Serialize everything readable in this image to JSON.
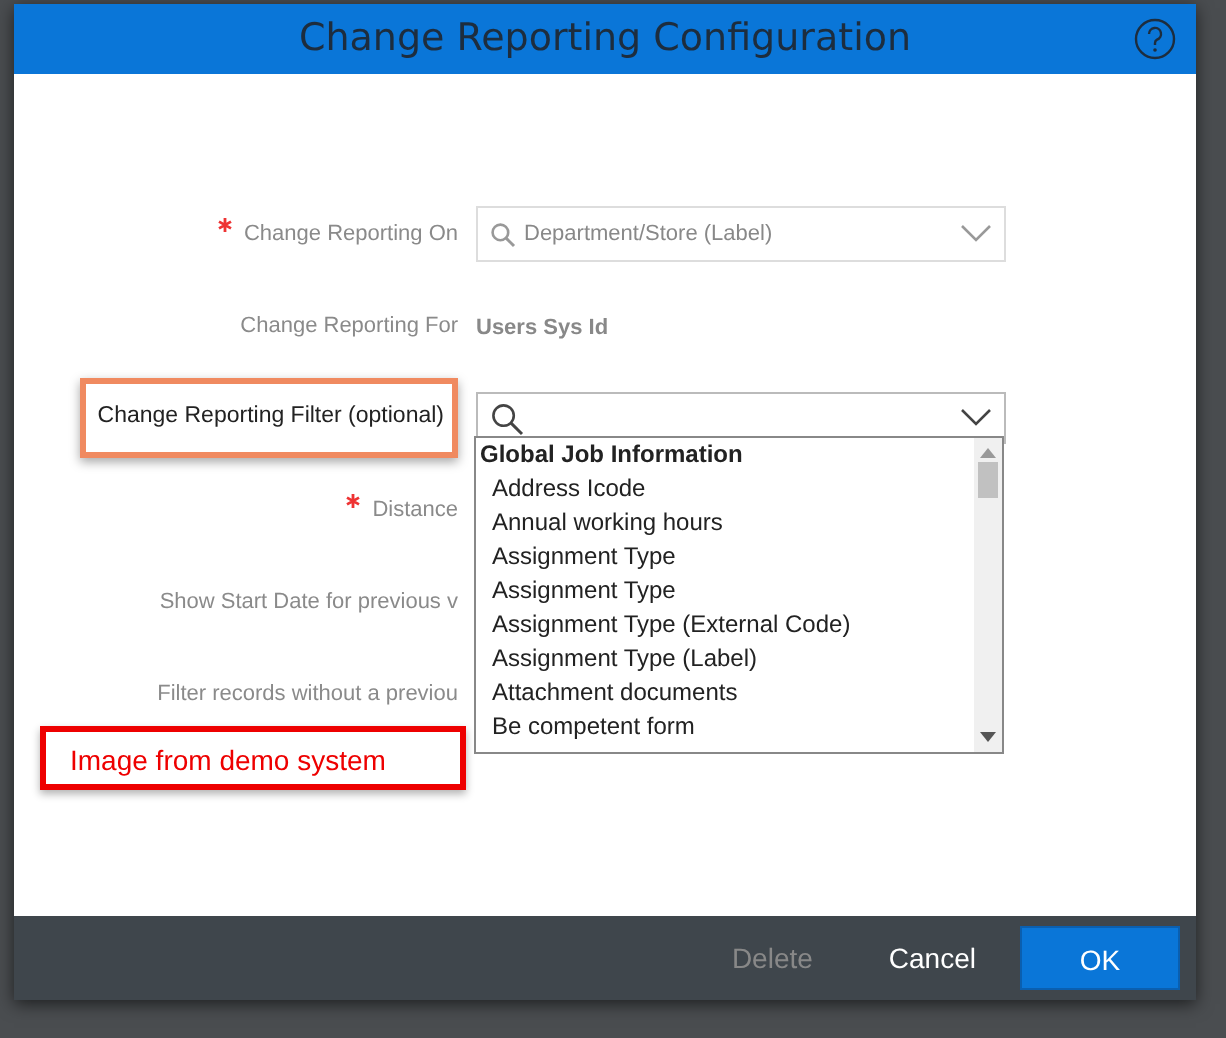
{
  "dialog": {
    "title": "Change Reporting Configuration"
  },
  "fields": [
    {
      "kind": "select",
      "label": "Change Reporting On",
      "required": true,
      "highlighted": false,
      "value": "Department/Store (Label)"
    },
    {
      "kind": "text",
      "label": "Change Reporting For",
      "required": false,
      "highlighted": false,
      "value": "Users Sys Id"
    },
    {
      "kind": "combo",
      "label": "Change Reporting Filter (optional)",
      "required": false,
      "highlighted": true
    },
    {
      "kind": "blank",
      "label": "Distance",
      "required": true,
      "highlighted": false
    },
    {
      "kind": "blank",
      "label": "Show Start Date for previous v",
      "required": false,
      "highlighted": false
    },
    {
      "kind": "blank",
      "label": "Filter records without a previou",
      "required": false,
      "highlighted": false
    }
  ],
  "dropdown": {
    "group": "Global Job Information",
    "options": [
      "Address Icode",
      "Annual working hours",
      "Assignment Type",
      "Assignment Type",
      "Assignment Type (External Code)",
      "Assignment Type (Label)",
      "Attachment documents",
      "Be competent form"
    ]
  },
  "note": "Image from demo system",
  "buttons": [
    {
      "label": "Delete",
      "kind": "link",
      "disabled": true
    },
    {
      "label": "Cancel",
      "kind": "link",
      "disabled": false
    },
    {
      "label": "OK",
      "kind": "primary",
      "disabled": false
    }
  ]
}
